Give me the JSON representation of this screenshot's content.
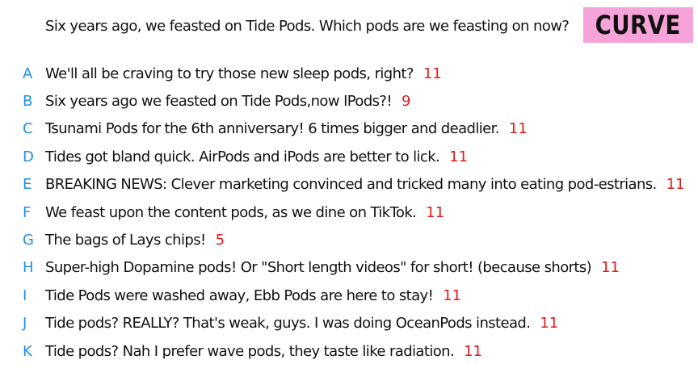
{
  "question": "Six years ago, we feasted on Tide Pods. Which pods are we feasting on now?",
  "badge": {
    "label": "CURVE",
    "color": "#f5a3d8"
  },
  "colors": {
    "letter": "#1f8fe8",
    "score": "#e21a1a",
    "text": "#111111"
  },
  "answers": [
    {
      "letter": "A",
      "text": "We'll all be craving to try those new sleep pods, right?",
      "score": "11"
    },
    {
      "letter": "B",
      "text": "Six years ago we feasted on Tide Pods,now IPods?!",
      "score": "9"
    },
    {
      "letter": "C",
      "text": "Tsunami Pods for the 6th anniversary! 6 times bigger and deadlier.",
      "score": "11"
    },
    {
      "letter": "D",
      "text": "Tides got bland quick. AirPods and iPods are better to lick.",
      "score": "11"
    },
    {
      "letter": "E",
      "text": "BREAKING NEWS: Clever marketing convinced and tricked many into eating pod-estrians.",
      "score": "11"
    },
    {
      "letter": "F",
      "text": "We feast upon the content pods, as we dine on TikTok.",
      "score": "11"
    },
    {
      "letter": "G",
      "text": "The bags of Lays chips!",
      "score": "5"
    },
    {
      "letter": "H",
      "text": "Super-high Dopamine pods! Or \"Short length videos\" for short! (because shorts)",
      "score": "11"
    },
    {
      "letter": "I",
      "text": "Tide Pods were washed away, Ebb Pods are here to stay!",
      "score": "11"
    },
    {
      "letter": "J",
      "text": "Tide pods? REALLY? That's weak, guys. I was doing OceanPods instead.",
      "score": "11"
    },
    {
      "letter": "K",
      "text": "Tide pods? Nah I prefer wave pods, they taste like radiation.",
      "score": "11"
    }
  ]
}
